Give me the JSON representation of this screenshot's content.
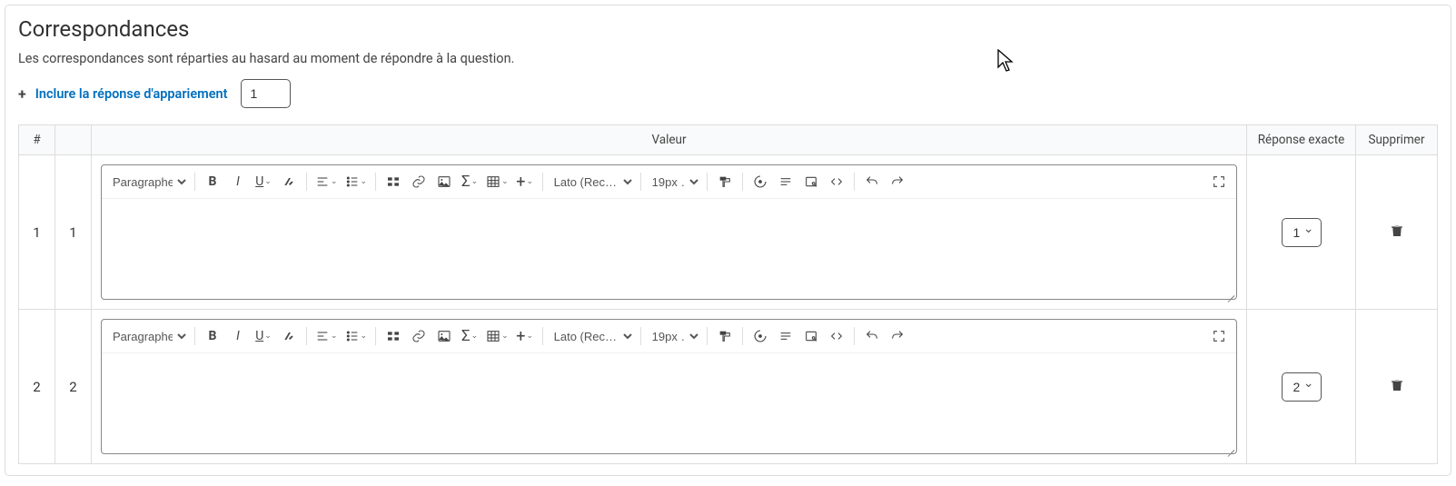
{
  "heading": "Correspondances",
  "description": "Les correspondances sont réparties au hasard au moment de répondre à la question.",
  "add_link_label": "Inclure la réponse d'appariement",
  "add_count_value": "1",
  "columns": {
    "hash": "#",
    "value": "Valeur",
    "exact": "Réponse exacte",
    "delete": "Supprimer"
  },
  "toolbar": {
    "paragraph_label": "Paragraphe",
    "font_label": "Lato (Recom…",
    "size_label": "19px …"
  },
  "rows": [
    {
      "index": "1",
      "sub": "1",
      "exact_value": "1"
    },
    {
      "index": "2",
      "sub": "2",
      "exact_value": "2"
    }
  ]
}
